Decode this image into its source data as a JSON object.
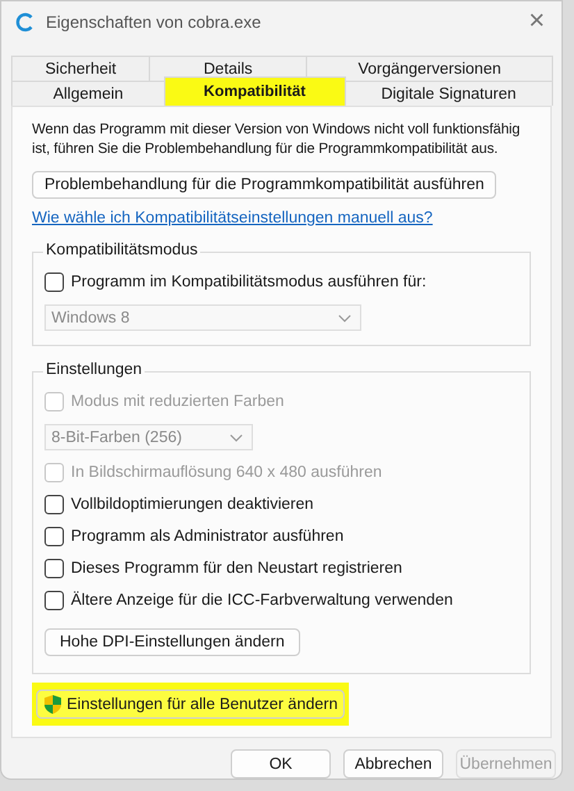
{
  "window": {
    "title": "Eigenschaften von cobra.exe",
    "close": "×"
  },
  "tab_rows": [
    [
      {
        "label": "Sicherheit",
        "selected": false,
        "highlighted": false
      },
      {
        "label": "Details",
        "selected": false,
        "highlighted": false
      },
      {
        "label": "Vorgängerversionen",
        "selected": false,
        "highlighted": false
      }
    ],
    [
      {
        "label": "Allgemein",
        "selected": false,
        "highlighted": false
      },
      {
        "label": "Kompatibilität",
        "selected": true,
        "highlighted": true
      },
      {
        "label": "Digitale Signaturen",
        "selected": false,
        "highlighted": false
      }
    ]
  ],
  "intro": "Wenn das Programm mit dieser Version von Windows nicht voll funktionsfähig ist, führen Sie die Problembehandlung für die Programmkompatibilität aus.",
  "troubleshoot_button": "Problembehandlung für die Programmkompatibilität ausführen",
  "help_link": "Wie wähle ich Kompatibilitätseinstellungen manuell aus?",
  "groups": [
    {
      "title": "Kompatibilitätsmodus",
      "items": [
        {
          "kind": "checkbox",
          "label": "Programm im Kompatibilitätsmodus ausführen für:",
          "checked": false,
          "disabled": false
        },
        {
          "kind": "dropdown",
          "value": "Windows 8",
          "disabled": true
        }
      ]
    },
    {
      "title": "Einstellungen",
      "items": [
        {
          "kind": "checkbox",
          "label": "Modus mit reduzierten Farben",
          "checked": false,
          "disabled": true
        },
        {
          "kind": "dropdown",
          "value": "8-Bit-Farben (256)",
          "disabled": true
        },
        {
          "kind": "checkbox",
          "label": "In Bildschirmauflösung 640 x 480 ausführen",
          "checked": false,
          "disabled": true
        },
        {
          "kind": "checkbox",
          "label": "Vollbildoptimierungen deaktivieren",
          "checked": false,
          "disabled": false
        },
        {
          "kind": "checkbox",
          "label": "Programm als Administrator ausführen",
          "checked": false,
          "disabled": false
        },
        {
          "kind": "checkbox",
          "label": "Dieses Programm für den Neustart registrieren",
          "checked": false,
          "disabled": false
        },
        {
          "kind": "checkbox",
          "label": "Ältere Anzeige für die ICC-Farbverwaltung verwenden",
          "checked": false,
          "disabled": false
        },
        {
          "kind": "button",
          "label": "Hohe DPI-Einstellungen ändern"
        }
      ]
    }
  ],
  "all_users_button": {
    "label": "Einstellungen für alle Benutzer ändern",
    "highlighted": true
  },
  "buttons": [
    {
      "label": "OK",
      "disabled": false
    },
    {
      "label": "Abbrechen",
      "disabled": false
    },
    {
      "label": "Übernehmen",
      "disabled": true
    }
  ]
}
